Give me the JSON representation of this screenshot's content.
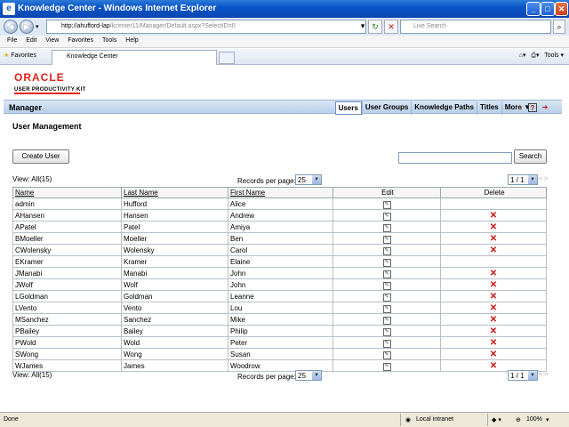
{
  "window": {
    "title": "Knowledge Center - Windows Internet Explorer"
  },
  "address": {
    "host": "http://ahufford-lap",
    "path": "/kcenter11/Manager/Default.aspx?SelectID=0"
  },
  "livesearch": {
    "placeholder": "Live Search"
  },
  "menu": [
    "File",
    "Edit",
    "View",
    "Favorites",
    "Tools",
    "Help"
  ],
  "tabs": {
    "favorites": "Favorites",
    "tab1": "Knowledge Center",
    "tools": "Tools"
  },
  "brand": {
    "logo": "ORACLE",
    "product": "USER PRODUCTIVITY KIT"
  },
  "manager": {
    "title": "Manager",
    "tabs": [
      "Users",
      "User Groups",
      "Knowledge Paths",
      "Titles",
      "More ▼"
    ]
  },
  "page": {
    "title": "User Management",
    "create_label": "Create User",
    "search_label": "Search"
  },
  "paging": {
    "view_all": "View: All(15)",
    "records_label": "Records per page:",
    "records_value": "25",
    "page_value": "1 / 1"
  },
  "table": {
    "headers": [
      "Name",
      "Last Name",
      "First Name",
      "Edit",
      "Delete"
    ],
    "rows": [
      {
        "name": "admin",
        "last": "Hufford",
        "first": "Alice",
        "delete": false
      },
      {
        "name": "AHansen",
        "last": "Hansen",
        "first": "Andrew",
        "delete": true
      },
      {
        "name": "APatel",
        "last": "Patel",
        "first": "Amiya",
        "delete": true
      },
      {
        "name": "BMoeller",
        "last": "Moeller",
        "first": "Ben",
        "delete": true
      },
      {
        "name": "CWolensky",
        "last": "Wolensky",
        "first": "Carol",
        "delete": true
      },
      {
        "name": "EKramer",
        "last": "Kramer",
        "first": "Elaine",
        "delete": false
      },
      {
        "name": "JManabi",
        "last": "Manabi",
        "first": "John",
        "delete": true
      },
      {
        "name": "JWolf",
        "last": "Wolf",
        "first": "John",
        "delete": true
      },
      {
        "name": "LGoldman",
        "last": "Goldman",
        "first": "Leanne",
        "delete": true
      },
      {
        "name": "LVento",
        "last": "Vento",
        "first": "Lou",
        "delete": true
      },
      {
        "name": "MSanchez",
        "last": "Sanchez",
        "first": "Mike",
        "delete": true
      },
      {
        "name": "PBailey",
        "last": "Bailey",
        "first": "Philip",
        "delete": true
      },
      {
        "name": "PWold",
        "last": "Wold",
        "first": "Peter",
        "delete": true
      },
      {
        "name": "SWong",
        "last": "Wong",
        "first": "Susan",
        "delete": true
      },
      {
        "name": "WJames",
        "last": "James",
        "first": "Woodrow",
        "delete": true
      }
    ]
  },
  "status": {
    "left": "Done",
    "zone": "Local intranet",
    "zoom": "100%"
  }
}
